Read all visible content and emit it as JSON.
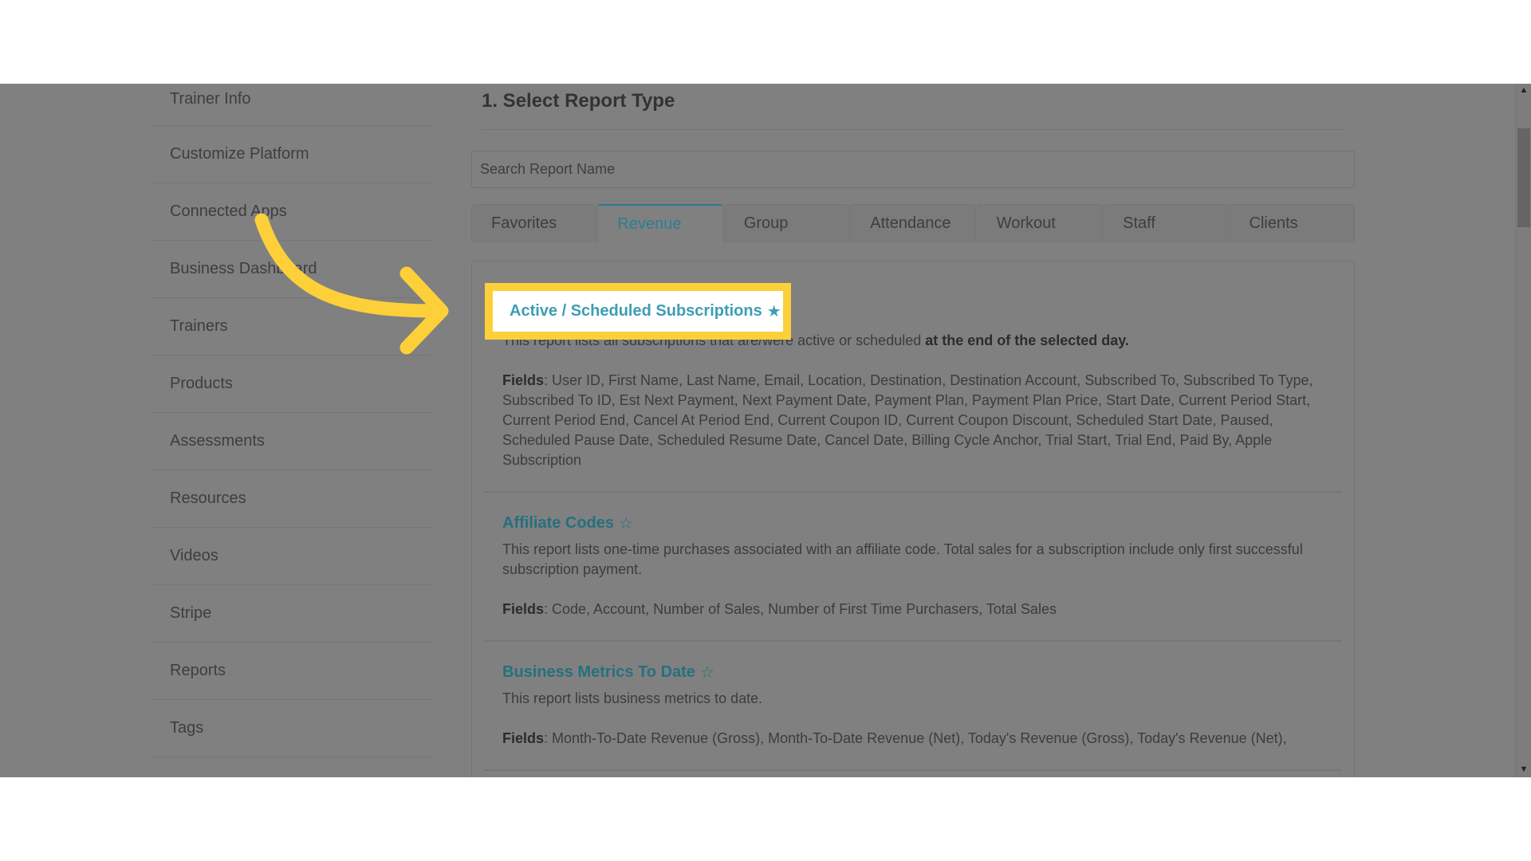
{
  "sidebar": {
    "items": [
      {
        "label": "Trainer Info"
      },
      {
        "label": "Customize Platform"
      },
      {
        "label": "Connected Apps"
      },
      {
        "label": "Business Dashboard"
      },
      {
        "label": "Trainers"
      },
      {
        "label": "Products"
      },
      {
        "label": "Assessments"
      },
      {
        "label": "Resources"
      },
      {
        "label": "Videos"
      },
      {
        "label": "Stripe"
      },
      {
        "label": "Reports"
      },
      {
        "label": "Tags"
      }
    ]
  },
  "main": {
    "section_title": "1. Select Report Type",
    "search": {
      "placeholder": "Search Report Name",
      "value": ""
    },
    "tabs": [
      {
        "label": "Favorites",
        "active": false
      },
      {
        "label": "Revenue",
        "active": true
      },
      {
        "label": "Group",
        "active": false
      },
      {
        "label": "Attendance",
        "active": false
      },
      {
        "label": "Workout",
        "active": false
      },
      {
        "label": "Staff",
        "active": false
      },
      {
        "label": "Clients",
        "active": false
      }
    ],
    "reports": [
      {
        "title": "Active / Scheduled Subscriptions",
        "favorited": true,
        "star_icon": "star-filled-icon",
        "description": "This report lists all subscriptions that are/were active or scheduled",
        "description_bold": "at the end of the selected day.",
        "fields_label": "Fields",
        "fields": ": User ID, First Name, Last Name, Email, Location, Destination, Destination Account, Subscribed To, Subscribed To Type, Subscribed To ID, Est Next Payment, Next Payment Date, Payment Plan, Payment Plan Price, Start Date, Current Period Start, Current Period End, Cancel At Period End, Current Coupon ID, Current Coupon Discount, Scheduled Start Date, Paused, Scheduled Pause Date, Scheduled Resume Date, Cancel Date, Billing Cycle Anchor, Trial Start, Trial End, Paid By, Apple Subscription"
      },
      {
        "title": "Affiliate Codes",
        "favorited": false,
        "star_icon": "star-outline-icon",
        "description": "This report lists one-time purchases associated with an affiliate code. Total sales for a subscription include only first successful subscription payment.",
        "fields_label": "Fields",
        "fields": ": Code, Account, Number of Sales, Number of First Time Purchasers, Total Sales"
      },
      {
        "title": "Business Metrics To Date",
        "favorited": false,
        "star_icon": "star-outline-icon",
        "description": "This report lists business metrics to date.",
        "fields_label": "Fields",
        "fields": ": Month-To-Date Revenue (Gross), Month-To-Date Revenue (Net), Today's Revenue (Gross), Today's Revenue (Net),"
      }
    ]
  },
  "icons": {
    "star_filled": "★",
    "star_outline": "☆",
    "scroll_up": "▲",
    "scroll_down": "▼"
  },
  "colors": {
    "highlight": "#fdd039",
    "accent": "#3d9db4",
    "overlay": "#808080"
  }
}
